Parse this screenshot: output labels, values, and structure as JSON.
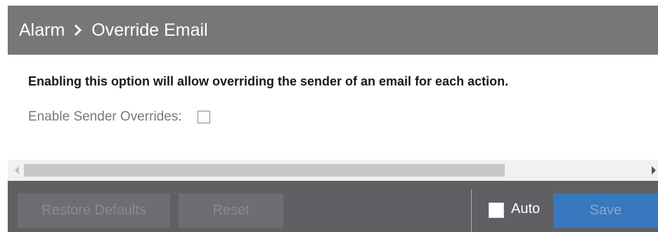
{
  "header": {
    "breadcrumb_root": "Alarm",
    "breadcrumb_current": "Override Email"
  },
  "content": {
    "description": "Enabling this option will allow overriding the sender of an email for each action.",
    "enable_label": "Enable Sender Overrides:",
    "enable_checked": false
  },
  "footer": {
    "restore_defaults_label": "Restore Defaults",
    "reset_label": "Reset",
    "auto_label": "Auto",
    "auto_checked": false,
    "save_label": "Save"
  },
  "colors": {
    "header_bg": "#77777a",
    "footer_bg": "#606064",
    "save_button": "#3778be"
  },
  "icons": {
    "breadcrumb_separator": "chevron-right-icon",
    "scroll_left": "triangle-left-icon",
    "scroll_right": "triangle-right-icon"
  }
}
